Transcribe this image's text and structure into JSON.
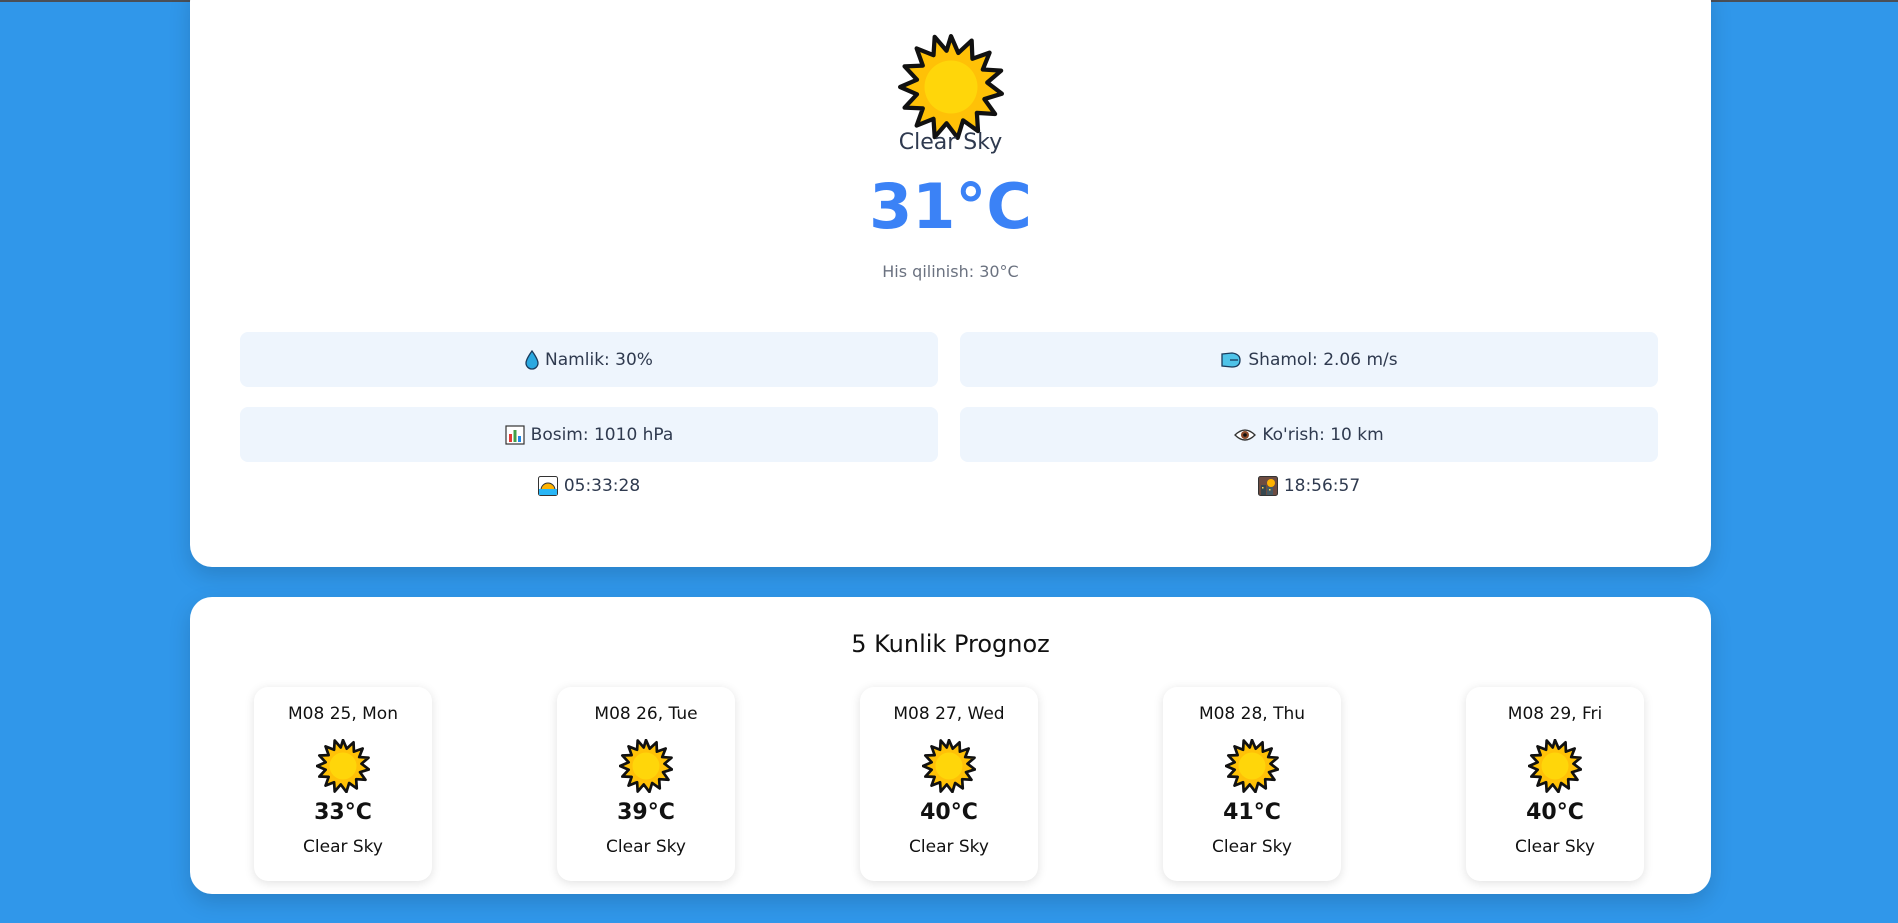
{
  "current": {
    "icon": "sun-icon",
    "description": "Clear Sky",
    "temperature": "31°C",
    "feels_like": "His qilinish: 30°C",
    "stats": {
      "humidity": "Namlik: 30%",
      "wind": "Shamol: 2.06 m/s",
      "pressure": "Bosim: 1010 hPa",
      "visibility": "Ko'rish: 10 km"
    },
    "sunrise": "05:33:28",
    "sunset": "18:56:57"
  },
  "forecast": {
    "title": "5 Kunlik Prognoz",
    "days": [
      {
        "date": "M08 25, Mon",
        "temp": "33°C",
        "desc": "Clear Sky"
      },
      {
        "date": "M08 26, Tue",
        "temp": "39°C",
        "desc": "Clear Sky"
      },
      {
        "date": "M08 27, Wed",
        "temp": "40°C",
        "desc": "Clear Sky"
      },
      {
        "date": "M08 28, Thu",
        "temp": "41°C",
        "desc": "Clear Sky"
      },
      {
        "date": "M08 29, Fri",
        "temp": "40°C",
        "desc": "Clear Sky"
      }
    ]
  },
  "colors": {
    "background": "#3097ea",
    "accent": "#3b82f6",
    "stat_bg": "#eef5fd"
  }
}
